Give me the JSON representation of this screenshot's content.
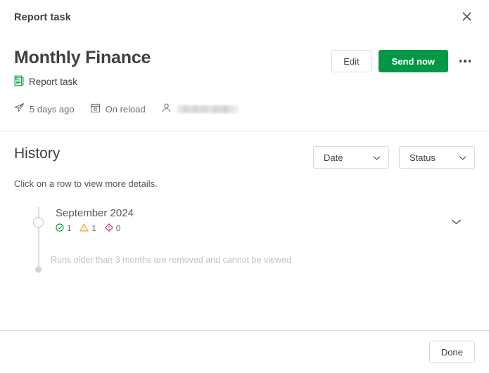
{
  "header": {
    "title": "Report task",
    "close_label": "Close"
  },
  "task": {
    "name": "Monthly Finance",
    "type_label": "Report task",
    "meta": {
      "last_run": "5 days ago",
      "trigger": "On reload",
      "owner": ""
    }
  },
  "actions": {
    "edit_label": "Edit",
    "send_now_label": "Send now",
    "more_label": "More options"
  },
  "history": {
    "title": "History",
    "hint": "Click on a row to view more details.",
    "filters": [
      {
        "label": "Date"
      },
      {
        "label": "Status"
      }
    ],
    "runs": [
      {
        "period": "September 2024",
        "success_count": "1",
        "warning_count": "1",
        "error_count": "0"
      }
    ],
    "retention_note": "Runs older than 3 months are removed and cannot be viewed"
  },
  "footer": {
    "done_label": "Done"
  },
  "colors": {
    "primary_green": "#009845",
    "success": "#008a3d",
    "warning": "#f8981d",
    "error": "#d9205f",
    "text": "#404040",
    "muted": "#6e6e6e"
  }
}
